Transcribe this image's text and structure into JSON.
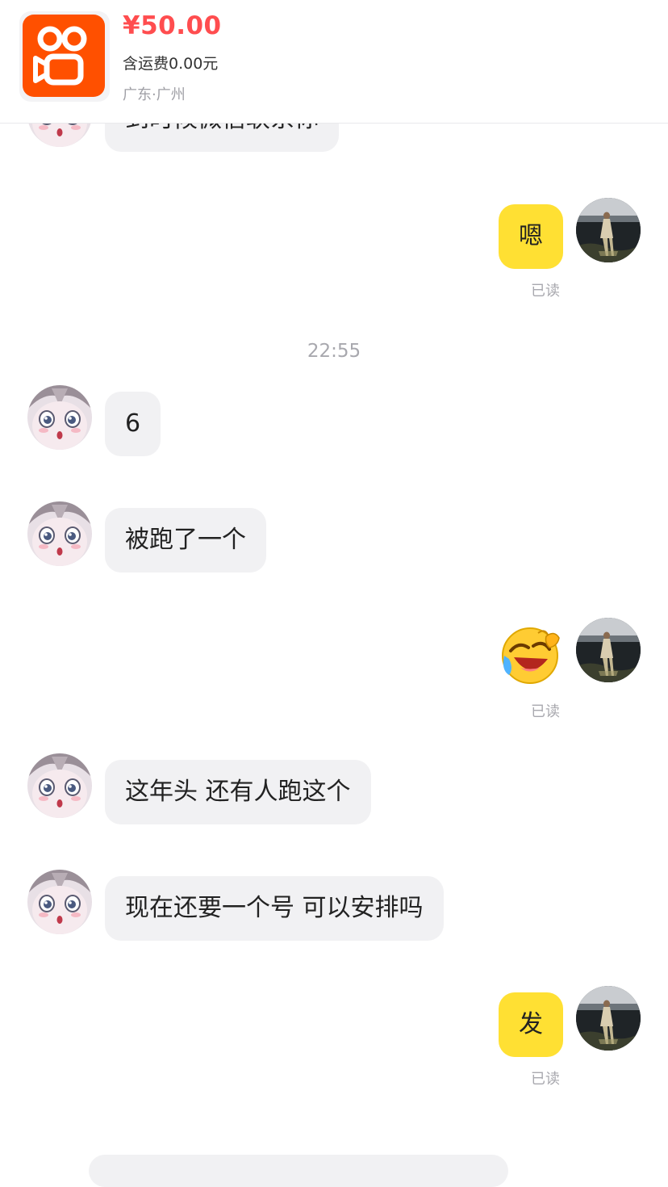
{
  "product": {
    "app_icon": "kuaishou-logo-icon",
    "price": "¥50.00",
    "shipping": "含运费0.00元",
    "location": "广东·广州"
  },
  "colors": {
    "price": "#ff4d4f",
    "self_bubble": "#ffe033",
    "other_bubble": "#f1f1f3",
    "app_brand": "#ff5000"
  },
  "messages": [
    {
      "sender": "other",
      "text": "到时候微信联系你"
    },
    {
      "sender": "self",
      "text": "嗯",
      "status": "已读"
    },
    {
      "sender": "self",
      "sticker": "laughing-crying-emoji-icon",
      "status": "已读"
    },
    {
      "sender": "other",
      "text": "6"
    },
    {
      "sender": "other",
      "text": "被跑了一个"
    },
    {
      "sender": "other",
      "text": "这年头 还有人跑这个"
    },
    {
      "sender": "other",
      "text": "现在还要一个号 可以安排吗"
    },
    {
      "sender": "self",
      "text": "发",
      "status": "已读"
    }
  ],
  "timestamp": "22:55"
}
